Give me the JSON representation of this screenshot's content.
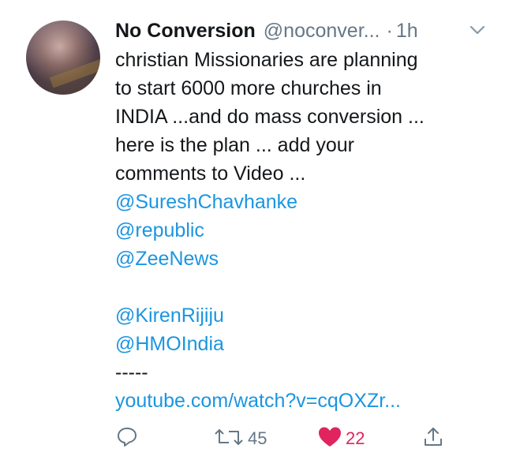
{
  "tweet": {
    "display_name": "No Conversion",
    "handle": "@noconver...",
    "separator": "·",
    "time": "1h",
    "lines": [
      {
        "text": "christian Missionaries are planning",
        "type": "text"
      },
      {
        "text": "to start 6000 more churches in",
        "type": "text"
      },
      {
        "text": "INDIA ...and do mass conversion ...",
        "type": "text"
      },
      {
        "text": "here is the plan ... add your",
        "type": "text"
      },
      {
        "text": "comments  to Video ...",
        "type": "text"
      },
      {
        "text": "@SureshChavhanke",
        "type": "mention"
      },
      {
        "text": "@republic",
        "type": "mention"
      },
      {
        "text": "@ZeeNews",
        "type": "mention"
      },
      {
        "text": "",
        "type": "blank"
      },
      {
        "text": "@KirenRijiju",
        "type": "mention"
      },
      {
        "text": "@HMOIndia",
        "type": "mention"
      },
      {
        "text": "-----",
        "type": "text"
      },
      {
        "text": "youtube.com/watch?v=cqOXZr...",
        "type": "link"
      }
    ]
  },
  "actions": {
    "reply_icon": "reply-icon",
    "retweet_icon": "retweet-icon",
    "retweet_count": "45",
    "like_icon": "heart-filled-icon",
    "like_count": "22",
    "share_icon": "share-icon"
  },
  "colors": {
    "text": "#14171a",
    "secondary": "#657786",
    "link": "#1b95e0",
    "like": "#e0245e"
  }
}
